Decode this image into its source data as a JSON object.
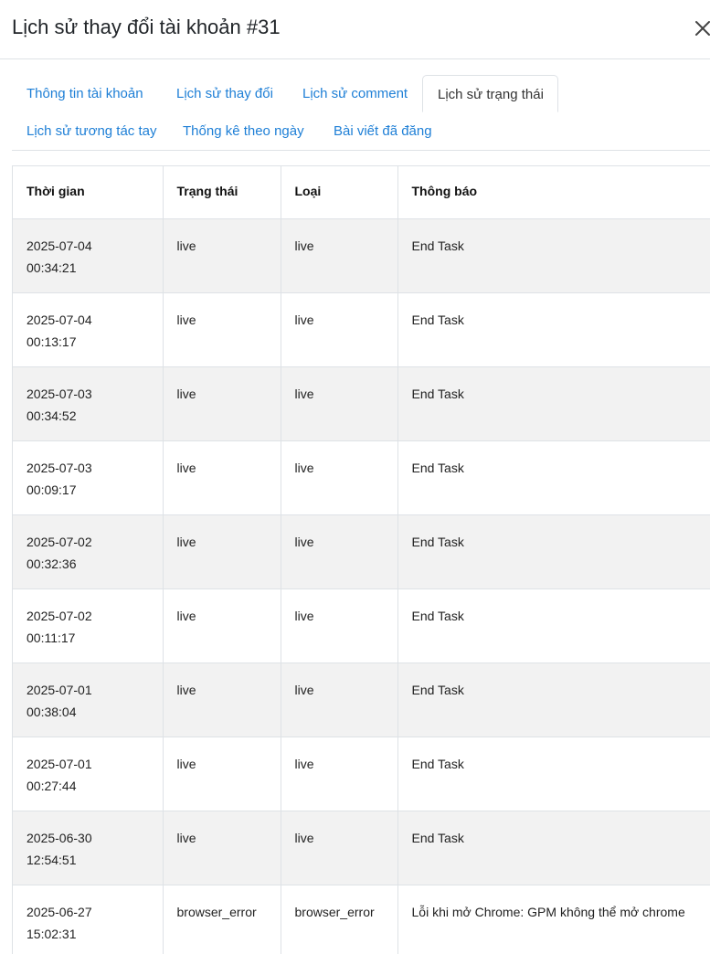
{
  "modal": {
    "title": "Lịch sử thay đổi tài khoản #31"
  },
  "tabs": [
    {
      "label": "Thông tin tài khoản",
      "active": false
    },
    {
      "label": "Lịch sử thay đổi",
      "active": false
    },
    {
      "label": "Lịch sử comment",
      "active": false
    },
    {
      "label": "Lịch sử trạng thái",
      "active": true
    },
    {
      "label": "Lịch sử tương tác tay",
      "active": false
    },
    {
      "label": "Thống kê theo ngày",
      "active": false
    },
    {
      "label": "Bài viết đã đăng",
      "active": false
    }
  ],
  "table": {
    "headers": [
      "Thời gian",
      "Trạng thái",
      "Loại",
      "Thông báo"
    ],
    "rows": [
      {
        "date": "2025-07-04",
        "time": "00:34:21",
        "status": "live",
        "type": "live",
        "message": "End Task"
      },
      {
        "date": "2025-07-04",
        "time": "00:13:17",
        "status": "live",
        "type": "live",
        "message": "End Task"
      },
      {
        "date": "2025-07-03",
        "time": "00:34:52",
        "status": "live",
        "type": "live",
        "message": "End Task"
      },
      {
        "date": "2025-07-03",
        "time": "00:09:17",
        "status": "live",
        "type": "live",
        "message": "End Task"
      },
      {
        "date": "2025-07-02",
        "time": "00:32:36",
        "status": "live",
        "type": "live",
        "message": "End Task"
      },
      {
        "date": "2025-07-02",
        "time": "00:11:17",
        "status": "live",
        "type": "live",
        "message": "End Task"
      },
      {
        "date": "2025-07-01",
        "time": "00:38:04",
        "status": "live",
        "type": "live",
        "message": "End Task"
      },
      {
        "date": "2025-07-01",
        "time": "00:27:44",
        "status": "live",
        "type": "live",
        "message": "End Task"
      },
      {
        "date": "2025-06-30",
        "time": "12:54:51",
        "status": "live",
        "type": "live",
        "message": "End Task"
      },
      {
        "date": "2025-06-27",
        "time": "15:02:31",
        "status": "browser_error",
        "type": "browser_error",
        "message": "Lỗi khi mở Chrome: GPM không thể mở chrome"
      }
    ]
  },
  "colors": {
    "link": "#1e7fd6",
    "row_stripe": "#f2f2f2",
    "border": "#dee2e6"
  },
  "icons": {
    "close": "close-icon"
  }
}
